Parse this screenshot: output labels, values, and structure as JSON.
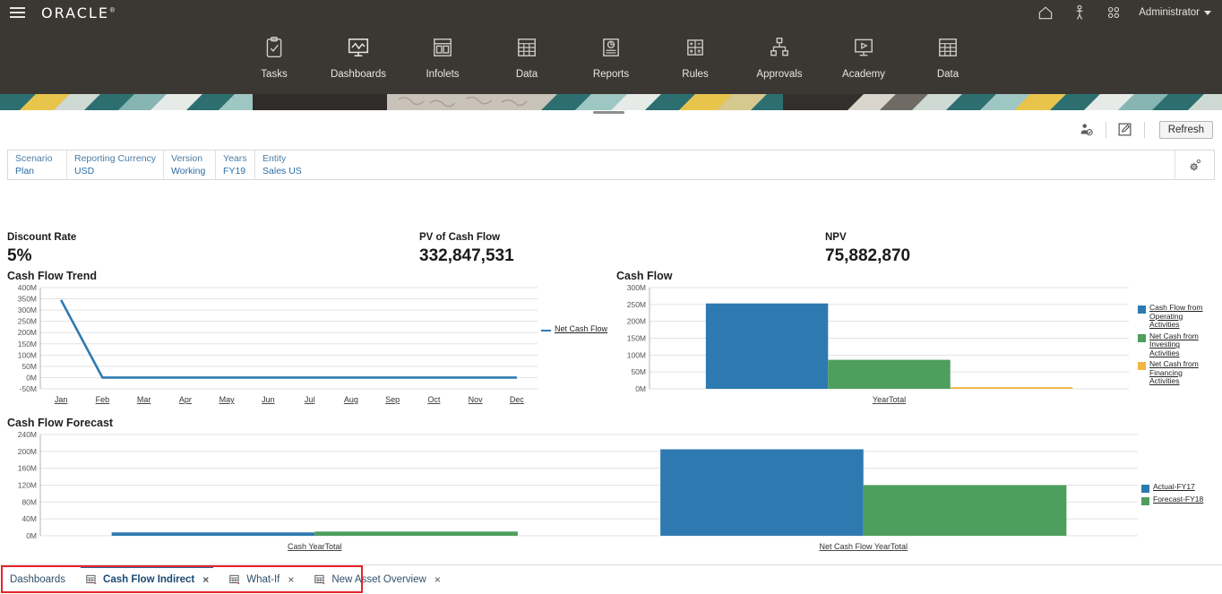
{
  "topbar": {
    "brand": "ORACLE",
    "menu_icon": "hamburger-icon",
    "home_icon": "home-icon",
    "accessibility_icon": "accessibility-icon",
    "apps_icon": "apps-grid-icon",
    "user_label": "Administrator"
  },
  "nav": {
    "items": [
      {
        "label": "Tasks",
        "icon": "clipboard-check-icon"
      },
      {
        "label": "Dashboards",
        "icon": "monitor-chart-icon"
      },
      {
        "label": "Infolets",
        "icon": "infolet-panels-icon"
      },
      {
        "label": "Data",
        "icon": "grid-table-icon"
      },
      {
        "label": "Reports",
        "icon": "report-document-icon"
      },
      {
        "label": "Rules",
        "icon": "calculator-icon"
      },
      {
        "label": "Approvals",
        "icon": "org-hierarchy-icon"
      },
      {
        "label": "Academy",
        "icon": "play-monitor-icon"
      },
      {
        "label": "Data",
        "icon": "grid-table-icon"
      }
    ]
  },
  "toolbar": {
    "user_settings_icon": "user-settings-icon",
    "edit_icon": "edit-pencil-icon",
    "refresh_label": "Refresh"
  },
  "pov": {
    "cells": [
      {
        "dimension": "Scenario",
        "value": "Plan"
      },
      {
        "dimension": "Reporting Currency",
        "value": "USD"
      },
      {
        "dimension": "Version",
        "value": "Working"
      },
      {
        "dimension": "Years",
        "value": "FY19"
      },
      {
        "dimension": "Entity",
        "value": "Sales US"
      }
    ],
    "settings_icon": "gear-icon"
  },
  "kpis": [
    {
      "label": "Discount Rate",
      "value": "5%"
    },
    {
      "label": "PV of Cash Flow",
      "value": "332,847,531"
    },
    {
      "label": "NPV",
      "value": "75,882,870"
    }
  ],
  "colors": {
    "blue": "#2e7ab0",
    "green": "#4e9e5d",
    "orange": "#f2b544",
    "accent_red": "#e8232a",
    "topbar": "#3b3833",
    "link": "#2b6ca3"
  },
  "chart_data": [
    {
      "type": "line",
      "title": "Cash Flow Trend",
      "categories": [
        "Jan",
        "Feb",
        "Mar",
        "Apr",
        "May",
        "Jun",
        "Jul",
        "Aug",
        "Sep",
        "Oct",
        "Nov",
        "Dec"
      ],
      "series": [
        {
          "name": "Net Cash Flow",
          "color": "#2e7ab0",
          "values": [
            345000000,
            0,
            0,
            0,
            0,
            0,
            0,
            0,
            0,
            0,
            0,
            0
          ]
        }
      ],
      "ylim": [
        -50000000,
        400000000
      ],
      "ytick_labels": [
        "400M",
        "350M",
        "300M",
        "250M",
        "200M",
        "150M",
        "100M",
        "50M",
        "0M",
        "-50M"
      ],
      "ytick_values": [
        400000000,
        350000000,
        300000000,
        250000000,
        200000000,
        150000000,
        100000000,
        50000000,
        0,
        -50000000
      ],
      "xlabel": "",
      "ylabel": "",
      "grid": true,
      "legend_position": "right"
    },
    {
      "type": "bar",
      "title": "Cash Flow",
      "categories": [
        "YearTotal"
      ],
      "series": [
        {
          "name": "Cash Flow from Operating Activities",
          "color": "#2e7ab0",
          "values": [
            253000000
          ]
        },
        {
          "name": "Net Cash from Investing Activities",
          "color": "#4e9e5d",
          "values": [
            86000000
          ]
        },
        {
          "name": "Net Cash from Financing Activities",
          "color": "#f2b544",
          "values": [
            5000000
          ]
        }
      ],
      "ylim": [
        0,
        300000000
      ],
      "ytick_labels": [
        "300M",
        "250M",
        "200M",
        "150M",
        "100M",
        "50M",
        "0M"
      ],
      "ytick_values": [
        300000000,
        250000000,
        200000000,
        150000000,
        100000000,
        50000000,
        0
      ],
      "xlabel": "",
      "ylabel": "",
      "grid": true,
      "legend_position": "right"
    },
    {
      "type": "bar",
      "title": "Cash Flow Forecast",
      "categories": [
        "Cash YearTotal",
        "Net Cash Flow YearTotal"
      ],
      "series": [
        {
          "name": "Actual-FY17",
          "color": "#2e7ab0",
          "values": [
            8000000,
            205000000
          ]
        },
        {
          "name": "Forecast-FY18",
          "color": "#4e9e5d",
          "values": [
            10000000,
            120000000
          ]
        }
      ],
      "ylim": [
        0,
        240000000
      ],
      "ytick_labels": [
        "240M",
        "200M",
        "160M",
        "120M",
        "80M",
        "40M",
        "0M"
      ],
      "ytick_values": [
        240000000,
        200000000,
        160000000,
        120000000,
        80000000,
        40000000,
        0
      ],
      "xlabel": "",
      "ylabel": "",
      "grid": true,
      "legend_position": "right"
    }
  ],
  "tabbar": {
    "tabs": [
      {
        "label": "Dashboards",
        "closeable": false,
        "active": false,
        "icon": null
      },
      {
        "label": "Cash Flow Indirect",
        "closeable": true,
        "active": true,
        "icon": "grid-form-icon",
        "close_label": "×"
      },
      {
        "label": "What-If",
        "closeable": true,
        "active": false,
        "icon": "grid-form-icon",
        "close_label": "×"
      },
      {
        "label": "New Asset Overview",
        "closeable": true,
        "active": false,
        "icon": "grid-form-icon",
        "close_label": "×"
      }
    ]
  }
}
